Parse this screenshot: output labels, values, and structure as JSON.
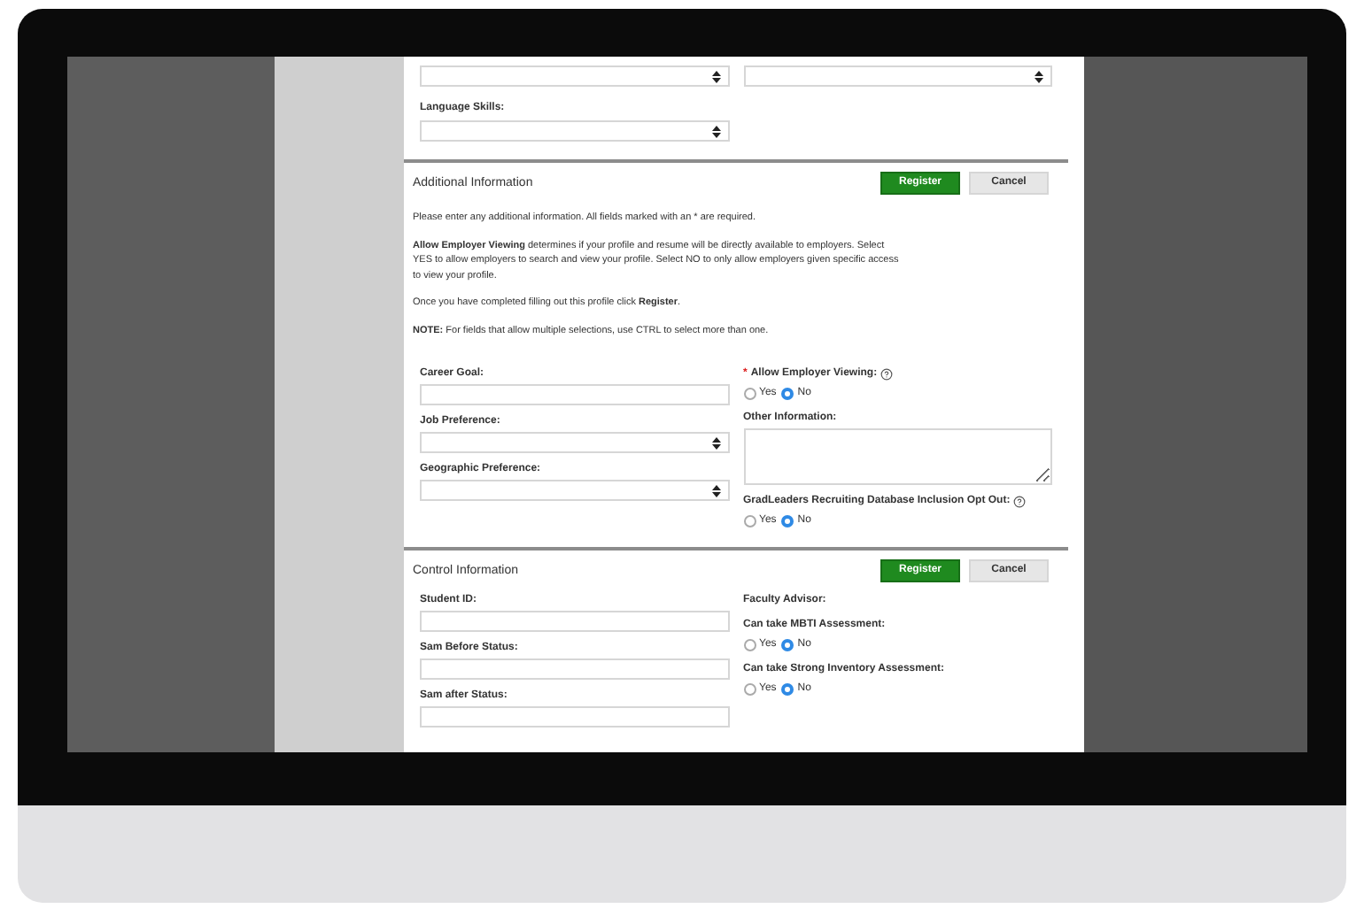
{
  "upper_dropdowns": [
    {
      "kind": "select"
    },
    {
      "kind": "select"
    }
  ],
  "language_skills": {
    "label": "Language Skills:",
    "kind": "select"
  },
  "sections": [
    {
      "title": "Additional Information",
      "buttons": [
        {
          "label": "Register",
          "kind": "primary"
        },
        {
          "label": "Cancel",
          "kind": "secondary"
        }
      ],
      "paragraphs": [
        "Please enter any additional information. All fields marked with an * are required.",
        "**Allow Employer Viewing** determines if your profile and resume will be directly available to employers. Select YES to allow employers to search and view your profile. Select NO to only allow employers given specific access to view your profile.",
        "Once you have completed filling out this profile click **Register**.",
        "**NOTE:** For fields that allow multiple selections, use CTRL to select more than one."
      ],
      "left_fields": [
        {
          "label": "Career Goal:",
          "kind": "text"
        },
        {
          "label": "Job Preference:",
          "kind": "select"
        },
        {
          "label": "Geographic Preference:",
          "kind": "select"
        }
      ],
      "right_fields": [
        {
          "label": "Allow Employer Viewing:",
          "kind": "radio",
          "required_mark": "*",
          "help": true,
          "options": [
            {
              "label": "Yes",
              "selected": false
            },
            {
              "label": "No",
              "selected": true
            }
          ]
        },
        {
          "label": "Other Information:",
          "kind": "textarea",
          "help": false
        },
        {
          "label": "GradLeaders Recruiting Database Inclusion Opt Out:",
          "kind": "radio",
          "help": true,
          "options": [
            {
              "label": "Yes",
              "selected": false
            },
            {
              "label": "No",
              "selected": true
            }
          ]
        }
      ]
    },
    {
      "title": "Control Information",
      "buttons": [
        {
          "label": "Register",
          "kind": "primary"
        },
        {
          "label": "Cancel",
          "kind": "secondary"
        }
      ],
      "left_fields": [
        {
          "label": "Student ID:",
          "kind": "text"
        },
        {
          "label": "Sam Before Status:",
          "kind": "text"
        },
        {
          "label": "Sam after Status:",
          "kind": "text"
        }
      ],
      "right_fields": [
        {
          "label": "Faculty Advisor:",
          "kind": "label",
          "help": false
        },
        {
          "label": "Can take MBTI Assessment:",
          "kind": "radio",
          "help": false,
          "options": [
            {
              "label": "Yes",
              "selected": false
            },
            {
              "label": "No",
              "selected": true
            }
          ]
        },
        {
          "label": "Can take Strong Inventory Assessment:",
          "kind": "radio",
          "help": false,
          "options": [
            {
              "label": "Yes",
              "selected": false
            },
            {
              "label": "No",
              "selected": true
            }
          ]
        }
      ]
    }
  ]
}
